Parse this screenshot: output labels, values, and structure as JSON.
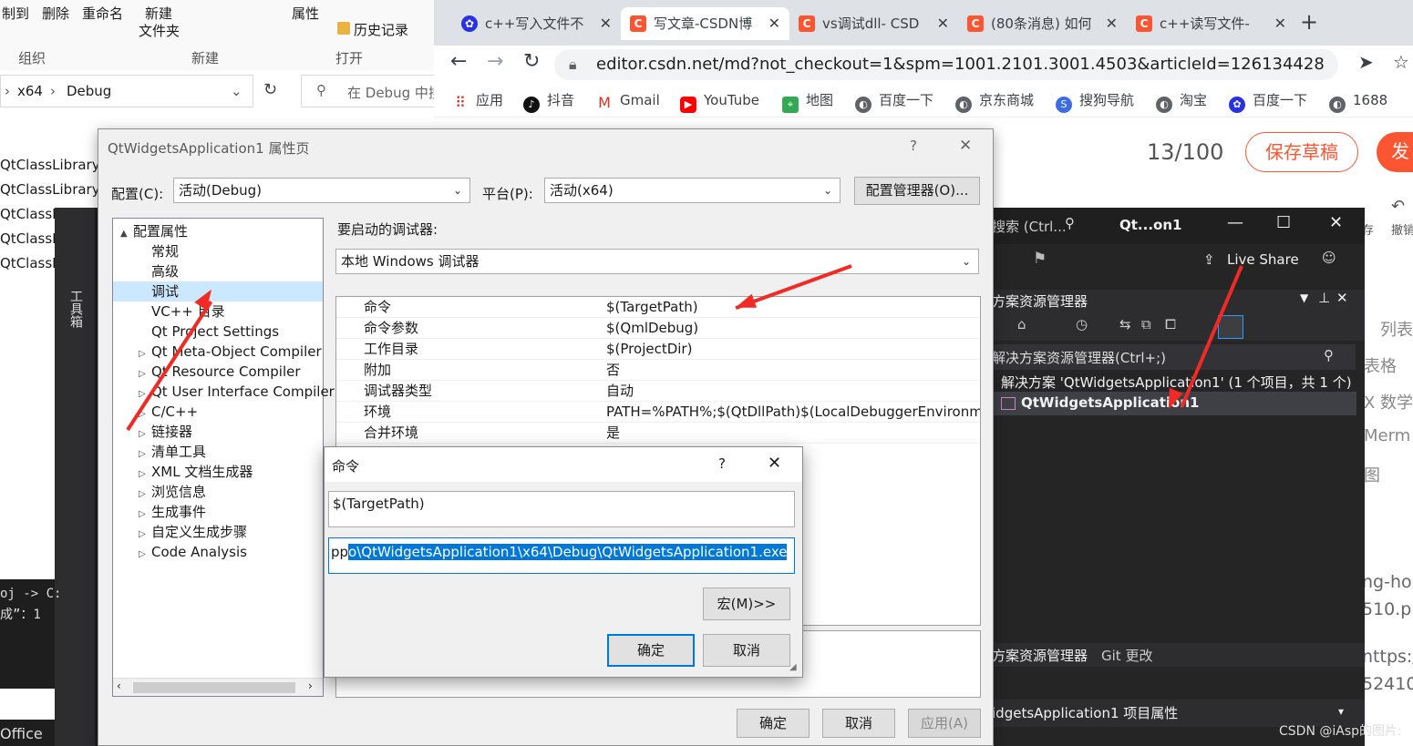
{
  "explorer": {
    "ribbon": {
      "copy_to": "制到",
      "delete": "删除",
      "rename": "重命名",
      "new_folder_line1": "新建",
      "new_folder_line2": "文件夹",
      "properties": "属性",
      "history": "历史记录",
      "group_org": "组织",
      "group_new": "新建",
      "group_open": "打开"
    },
    "breadcrumb": [
      "x64",
      "Debug"
    ],
    "search_placeholder": "在 Debug 中搜",
    "files": [
      "QtClassLibrary1.",
      "QtClassLibrary1.",
      "QtClassLib",
      "QtClassLib",
      "QtClassLib"
    ],
    "bottom_text": "Office",
    "console_lines": [
      "oj -> C:",
      "成”：1"
    ]
  },
  "browser": {
    "tabs": [
      {
        "label": "c++写入文件不",
        "icon": "baidu-paw-icon",
        "active": false
      },
      {
        "label": "写文章-CSDN博",
        "icon": "csdn-icon",
        "active": true
      },
      {
        "label": "vs调试dll- CSD",
        "icon": "csdn-icon",
        "active": false
      },
      {
        "label": "(80条消息) 如何",
        "icon": "csdn-icon",
        "active": false
      },
      {
        "label": "c++读写文件-",
        "icon": "csdn-icon",
        "active": false
      }
    ],
    "url": "editor.csdn.net/md?not_checkout=1&spm=1001.2101.3001.4503&articleId=126134428",
    "bookmarks": [
      "应用",
      "抖音",
      "Gmail",
      "YouTube",
      "地图",
      "百度一下",
      "京东商城",
      "搜狗导航",
      "淘宝",
      "百度一下",
      "1688"
    ],
    "editor": {
      "counter": "13/100",
      "save_draft": "保存草稿",
      "publish": "发",
      "undo": "撤销",
      "save": "存",
      "side_labels": [
        "列表",
        "表格",
        "X 数学",
        "Merm",
        "图"
      ],
      "side_text": [
        "ng-ho",
        "510.pn",
        "nttps:/",
        "524100"
      ],
      "watermark": "CSDN @iAsp的图片:"
    },
    "colors": {
      "accent": "#fc5531"
    }
  },
  "vs": {
    "search": "搜索 (Ctrl...",
    "title": "Qt...on1",
    "live_share": "Live Share",
    "toolbox": "工具箱",
    "solution_explorer": {
      "title": "方案资源管理器",
      "search": "解决方案资源管理器(Ctrl+;)",
      "solution_node": "解决方案 'QtWidgetsApplication1' (1 个项目，共 1 个)",
      "project_node": "QtWidgetsApplication1"
    },
    "bottom_tabs": [
      "方案资源管理器",
      "Git 更改"
    ],
    "properties_header": "idgetsApplication1  项目属性"
  },
  "props": {
    "title": "QtWidgetsApplication1 属性页",
    "help": "?",
    "config_label": "配置(C):",
    "config_value": "活动(Debug)",
    "platform_label": "平台(P):",
    "platform_value": "活动(x64)",
    "config_manager": "配置管理器(O)...",
    "debugger_label": "要启动的调试器:",
    "debugger_value": "本地 Windows 调试器",
    "tree": [
      {
        "label": "配置属性",
        "level": 0,
        "expander": "▲"
      },
      {
        "label": "常规",
        "level": 1,
        "expander": ""
      },
      {
        "label": "高级",
        "level": 1,
        "expander": ""
      },
      {
        "label": "调试",
        "level": 1,
        "expander": "",
        "selected": true
      },
      {
        "label": "VC++ 目录",
        "level": 1,
        "expander": ""
      },
      {
        "label": "Qt Project Settings",
        "level": 1,
        "expander": ""
      },
      {
        "label": "Qt Meta-Object Compiler",
        "level": 1,
        "expander": "▷"
      },
      {
        "label": "Qt Resource Compiler",
        "level": 1,
        "expander": "▷"
      },
      {
        "label": "Qt User Interface Compiler",
        "level": 1,
        "expander": "▷"
      },
      {
        "label": "C/C++",
        "level": 1,
        "expander": "▷"
      },
      {
        "label": "链接器",
        "level": 1,
        "expander": "▷"
      },
      {
        "label": "清单工具",
        "level": 1,
        "expander": "▷"
      },
      {
        "label": "XML 文档生成器",
        "level": 1,
        "expander": "▷"
      },
      {
        "label": "浏览信息",
        "level": 1,
        "expander": "▷"
      },
      {
        "label": "生成事件",
        "level": 1,
        "expander": "▷"
      },
      {
        "label": "自定义生成步骤",
        "level": 1,
        "expander": "▷"
      },
      {
        "label": "Code Analysis",
        "level": 1,
        "expander": "▷"
      }
    ],
    "grid": [
      {
        "key": "命令",
        "value": "$(TargetPath)"
      },
      {
        "key": "命令参数",
        "value": "$(QmlDebug)"
      },
      {
        "key": "工作目录",
        "value": "$(ProjectDir)"
      },
      {
        "key": "附加",
        "value": "否"
      },
      {
        "key": "调试器类型",
        "value": "自动"
      },
      {
        "key": "环境",
        "value": "PATH=%PATH%;$(QtDllPath)$(LocalDebuggerEnvironme"
      },
      {
        "key": "合并环境",
        "value": "是"
      }
    ],
    "ok": "确定",
    "cancel": "取消",
    "apply": "应用(A)"
  },
  "cmd": {
    "title": "命令",
    "help": "?",
    "value": "$(TargetPath)",
    "evaluated_prefix": "pp",
    "evaluated_selected": "o\\QtWidgetsApplication1\\x64\\Debug\\QtWidgetsApplication1.exe",
    "macro": "宏(M)>>",
    "ok": "确定",
    "cancel": "取消"
  }
}
